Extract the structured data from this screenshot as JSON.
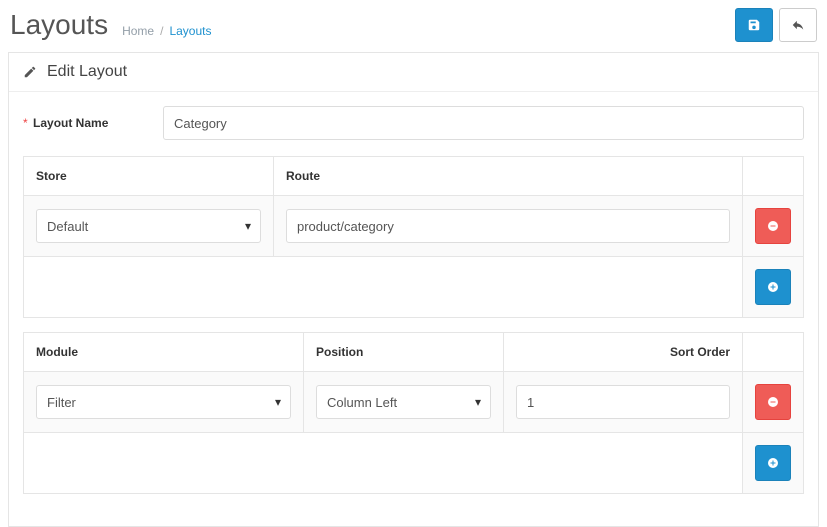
{
  "header": {
    "title": "Layouts",
    "breadcrumb": {
      "home": "Home",
      "current": "Layouts"
    }
  },
  "panel": {
    "title": "Edit Layout"
  },
  "form": {
    "layout_name_label": "Layout Name",
    "layout_name_value": "Category"
  },
  "routes_table": {
    "headers": {
      "store": "Store",
      "route": "Route"
    },
    "rows": [
      {
        "store": "Default",
        "route": "product/category"
      }
    ]
  },
  "modules_table": {
    "headers": {
      "module": "Module",
      "position": "Position",
      "sort_order": "Sort Order"
    },
    "rows": [
      {
        "module": "Filter",
        "position": "Column Left",
        "sort_order": "1"
      }
    ]
  }
}
